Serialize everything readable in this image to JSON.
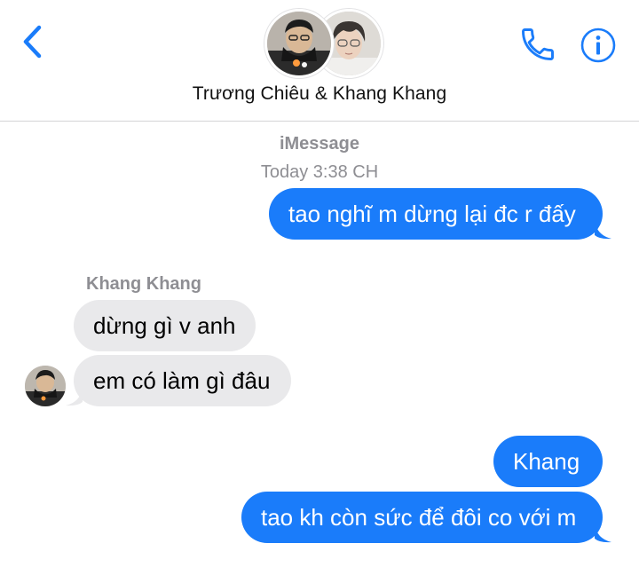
{
  "header": {
    "title": "Trương Chiêu  & Khang Khang",
    "back_icon": "chevron-left-icon",
    "call_icon": "phone-icon",
    "info_icon": "info-icon",
    "accent_color": "#1a7cfa"
  },
  "thread": {
    "service": "iMessage",
    "timestamp": "Today 3:38 CH",
    "sender_name": "Khang Khang",
    "messages": [
      {
        "direction": "outgoing",
        "text": "tao nghĩ m dừng lại đc r đấy"
      },
      {
        "direction": "incoming",
        "text": "dừng gì v anh"
      },
      {
        "direction": "incoming",
        "text": "em có làm gì đâu"
      },
      {
        "direction": "outgoing",
        "text": "Khang"
      },
      {
        "direction": "outgoing",
        "text": "tao kh còn sức để đôi co với m"
      }
    ]
  },
  "colors": {
    "outgoing_bubble": "#1a7cfa",
    "incoming_bubble": "#e9e9eb",
    "meta_text": "#8e8e93"
  }
}
